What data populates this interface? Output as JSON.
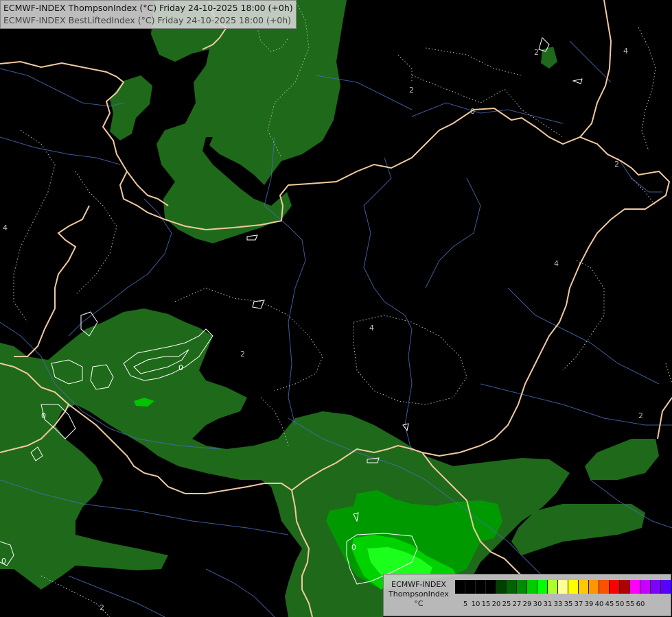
{
  "title_line1": "ECMWF-INDEX ThompsonIndex (°C) Friday 24-10-2025 18:00 (+0h)",
  "title_line2": "ECMWF-INDEX BestLiftedIndex (°C) Friday 24-10-2025 18:00 (+0h)",
  "legend": {
    "line1": "ECMWF-INDEX",
    "line2": "ThompsonIndex",
    "line3": "°C",
    "colors": [
      "#000000",
      "#000000",
      "#000000",
      "#000000",
      "#004000",
      "#006400",
      "#008C00",
      "#00CC00",
      "#00FF00",
      "#AEFF2E",
      "#FFFF99",
      "#FFFF00",
      "#FFC800",
      "#FF9600",
      "#FF5000",
      "#FF0000",
      "#B00000",
      "#FF00FF",
      "#C800FF",
      "#8000FF",
      "#5A00FF",
      "#0000FF"
    ],
    "ticks": [
      "5",
      "10",
      "15",
      "20",
      "25",
      "27",
      "29",
      "30",
      "31",
      "33",
      "35",
      "37",
      "39",
      "40",
      "45",
      "50",
      "55",
      "60"
    ]
  },
  "contour_labels": {
    "bli_zero_a": "0",
    "bli_zero_b": "0",
    "bli_zero_c": "0",
    "bli_zero_d": "0",
    "bli_two_a": "2",
    "bli_two_b": "2",
    "bli_two_c": "2",
    "bli_two_d": "2",
    "bli_two_e": "2",
    "bli_four_a": "4",
    "bli_four_b": "4",
    "bli_four_c": "4",
    "bli_four_d": "4",
    "bli_zero_e": "0"
  }
}
